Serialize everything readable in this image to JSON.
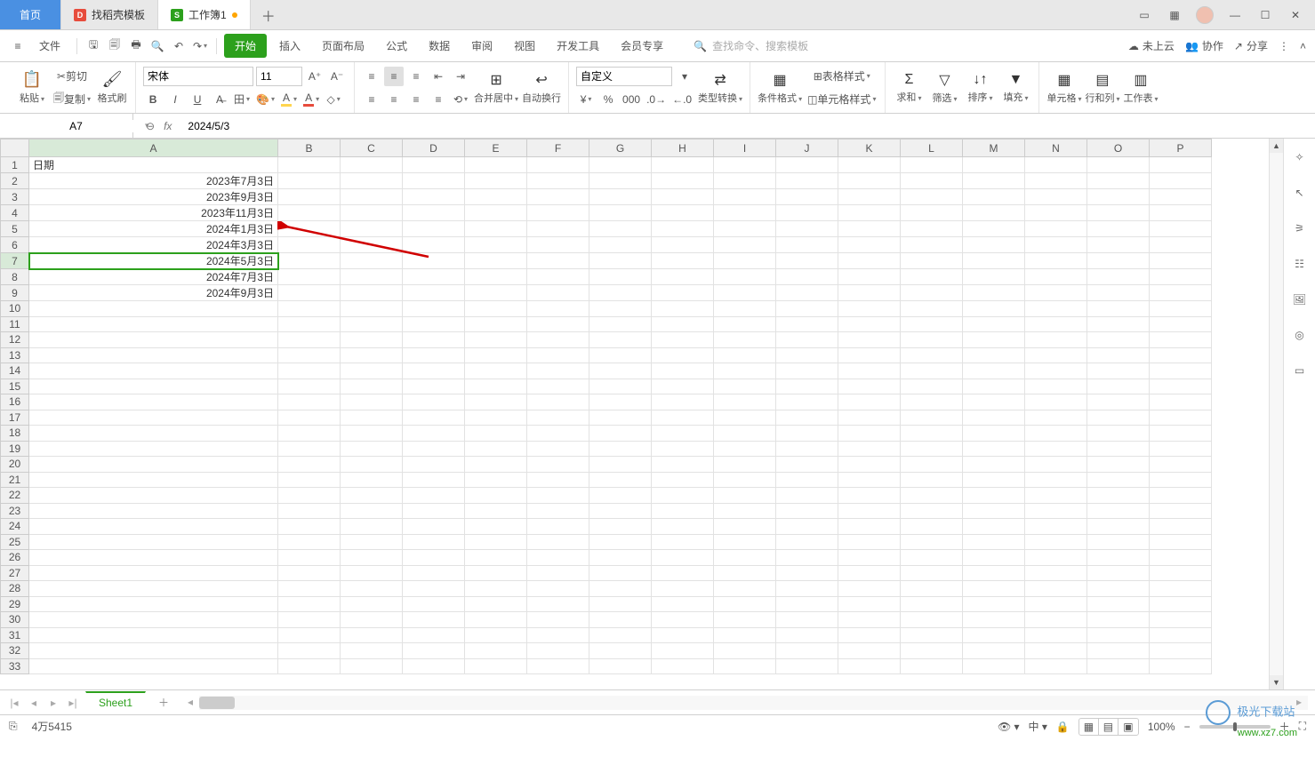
{
  "tabs": {
    "home": "首页",
    "templates": "找稻壳模板",
    "workbook": "工作簿1"
  },
  "menu": {
    "file": "文件",
    "items": [
      "开始",
      "插入",
      "页面布局",
      "公式",
      "数据",
      "审阅",
      "视图",
      "开发工具",
      "会员专享"
    ],
    "search_placeholder": "查找命令、搜索模板",
    "cloud": "未上云",
    "collab": "协作",
    "share": "分享"
  },
  "ribbon": {
    "paste": "粘贴",
    "cut": "剪切",
    "copy": "复制",
    "format_painter": "格式刷",
    "font_name": "宋体",
    "font_size": "11",
    "merge_center": "合并居中",
    "wrap_text": "自动换行",
    "num_format": "自定义",
    "type_convert": "类型转换",
    "cond_format": "条件格式",
    "table_style": "表格样式",
    "cell_style": "单元格样式",
    "sum": "求和",
    "filter": "筛选",
    "sort": "排序",
    "fill": "填充",
    "cells": "单元格",
    "rowcol": "行和列",
    "worksheet": "工作表"
  },
  "namebox": "A7",
  "formula": "2024/5/3",
  "columns": [
    "A",
    "B",
    "C",
    "D",
    "E",
    "F",
    "G",
    "H",
    "I",
    "J",
    "K",
    "L",
    "M",
    "N",
    "O",
    "P"
  ],
  "row_numbers": [
    1,
    2,
    3,
    4,
    5,
    6,
    7,
    8,
    9,
    10,
    11,
    12,
    13,
    14,
    15,
    16,
    17,
    18,
    19,
    20,
    21,
    22,
    23,
    24,
    25,
    26,
    27,
    28,
    29,
    30,
    31,
    32,
    33
  ],
  "cells": {
    "header": "日期",
    "A2": "2023年7月3日",
    "A3": "2023年9月3日",
    "A4": "2023年11月3日",
    "A5": "2024年1月3日",
    "A6": "2024年3月3日",
    "A7": "2024年5月3日",
    "A8": "2024年7月3日",
    "A9": "2024年9月3日"
  },
  "selected_row": 7,
  "sheet_tabs": [
    "Sheet1"
  ],
  "status": {
    "count": "4万5415",
    "zoom": "100%"
  },
  "watermark": {
    "title": "极光下载站",
    "url": "www.xz7.com"
  }
}
